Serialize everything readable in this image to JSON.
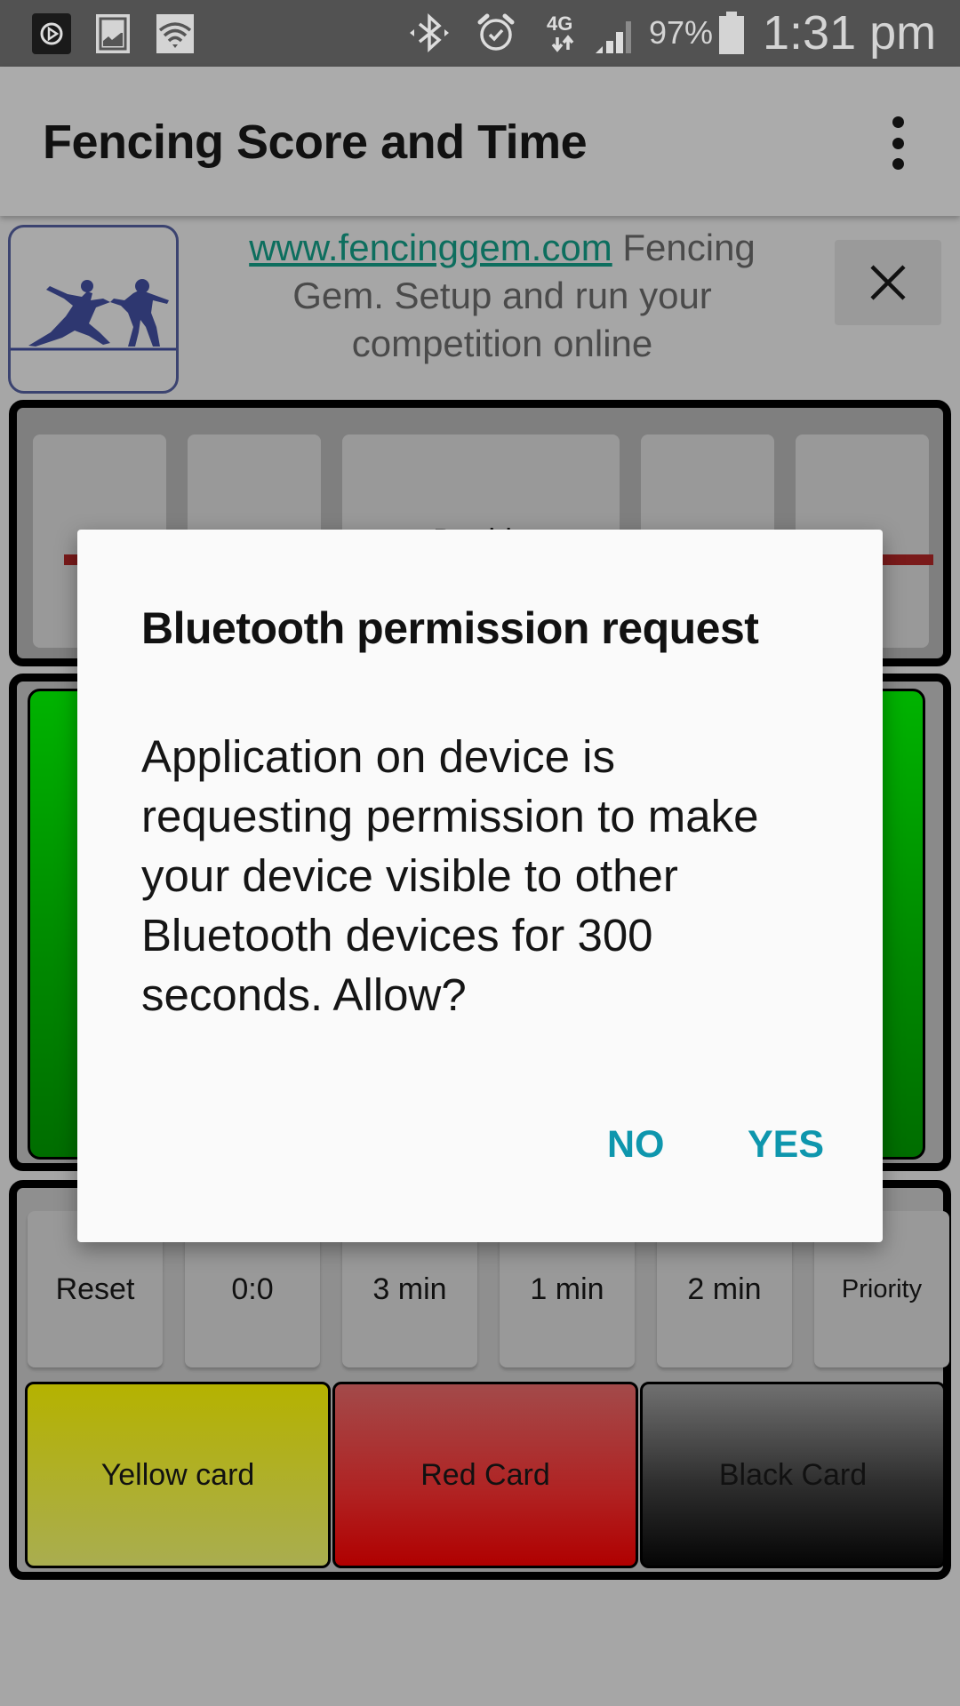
{
  "status_bar": {
    "battery_percent": "97%",
    "time": "1:31 pm",
    "network": "4G",
    "icons": [
      "media-app-icon",
      "gallery-icon",
      "wifi-icon",
      "bluetooth-icon",
      "alarm-icon",
      "4g-data-icon",
      "signal-icon",
      "battery-icon"
    ]
  },
  "app_bar": {
    "title": "Fencing Score and Time",
    "overflow_icon": "more-vert-icon"
  },
  "ad_banner": {
    "link_text": "www.fencinggem.com",
    "text": " Fencing Gem. Setup and run your competition online",
    "close_icon": "close-icon",
    "logo": "fencers-logo-icon"
  },
  "score_panel": {
    "buttons": [
      {
        "label": "",
        "icon": "minus-icon"
      },
      {
        "label": "",
        "icon": "plus-icon"
      },
      {
        "label": "Double",
        "icon": ""
      },
      {
        "label": "",
        "icon": "plus-icon"
      },
      {
        "label": "",
        "icon": "minus-icon"
      }
    ]
  },
  "controls": {
    "buttons": [
      "Reset",
      "0:0",
      "3 min",
      "1 min",
      "2 min",
      "Priority"
    ]
  },
  "cards": {
    "yellow": "Yellow card",
    "red": "Red Card",
    "black": "Black Card"
  },
  "colors": {
    "light_green": "#00b300",
    "link": "#0d6e5e",
    "dialog_button": "#0e96ad"
  },
  "dialog": {
    "title": "Bluetooth permission request",
    "body": "Application on device is requesting permission to make your device visible to other Bluetooth devices for 300 seconds. Allow?",
    "no": "NO",
    "yes": "YES"
  }
}
